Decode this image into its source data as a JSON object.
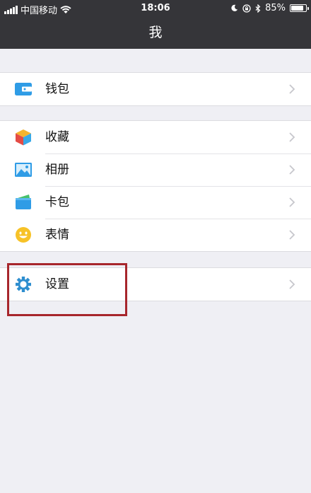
{
  "status_bar": {
    "carrier": "中国移动",
    "time": "18:06",
    "battery_text": "85%",
    "battery_level": 0.85
  },
  "header": {
    "title": "我"
  },
  "groups": [
    {
      "items": [
        {
          "label": "钱包",
          "icon": "wallet-icon"
        }
      ]
    },
    {
      "items": [
        {
          "label": "收藏",
          "icon": "favorites-cube-icon"
        },
        {
          "label": "相册",
          "icon": "album-picture-icon"
        },
        {
          "label": "卡包",
          "icon": "card-wallet-icon"
        },
        {
          "label": "表情",
          "icon": "smiley-icon"
        }
      ]
    },
    {
      "items": [
        {
          "label": "设置",
          "icon": "settings-gear-icon"
        }
      ]
    }
  ],
  "colors": {
    "nav_bg": "#353539",
    "page_bg": "#efeff4",
    "highlight": "#a7262c",
    "wallet": "#2f9ce6",
    "settings": "#2e8ecf"
  }
}
